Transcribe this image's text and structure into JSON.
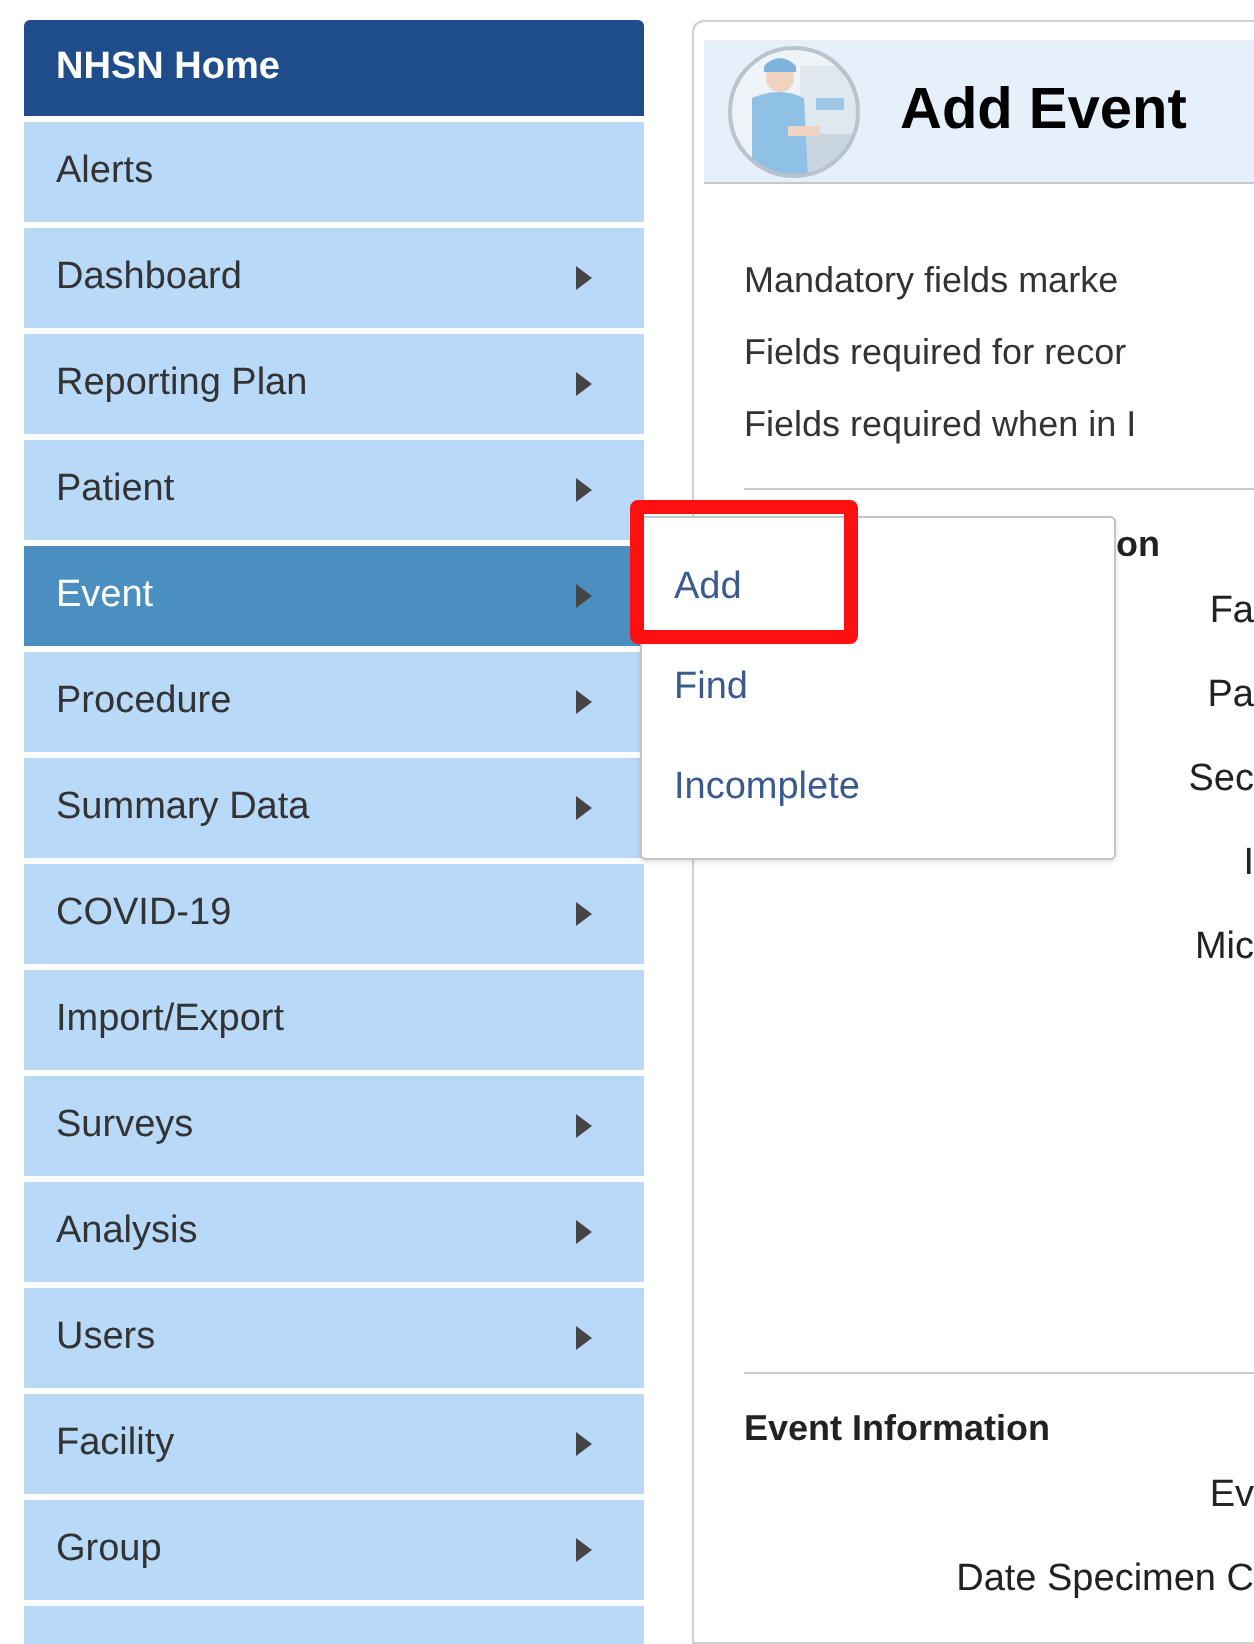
{
  "sidebar": {
    "header": "NHSN Home",
    "items": [
      {
        "label": "Alerts",
        "has_submenu": false,
        "selected": false
      },
      {
        "label": "Dashboard",
        "has_submenu": true,
        "selected": false
      },
      {
        "label": "Reporting Plan",
        "has_submenu": true,
        "selected": false
      },
      {
        "label": "Patient",
        "has_submenu": true,
        "selected": false
      },
      {
        "label": "Event",
        "has_submenu": true,
        "selected": true
      },
      {
        "label": "Procedure",
        "has_submenu": true,
        "selected": false
      },
      {
        "label": "Summary Data",
        "has_submenu": true,
        "selected": false
      },
      {
        "label": "COVID-19",
        "has_submenu": true,
        "selected": false
      },
      {
        "label": "Import/Export",
        "has_submenu": false,
        "selected": false
      },
      {
        "label": "Surveys",
        "has_submenu": true,
        "selected": false
      },
      {
        "label": "Analysis",
        "has_submenu": true,
        "selected": false
      },
      {
        "label": "Users",
        "has_submenu": true,
        "selected": false
      },
      {
        "label": "Facility",
        "has_submenu": true,
        "selected": false
      },
      {
        "label": "Group",
        "has_submenu": true,
        "selected": false
      }
    ]
  },
  "submenu": {
    "items": [
      {
        "label": "Add",
        "highlighted": true
      },
      {
        "label": "Find",
        "highlighted": false
      },
      {
        "label": "Incomplete",
        "highlighted": false
      }
    ]
  },
  "page": {
    "title": "Add Event",
    "notes": [
      "Mandatory fields marke",
      "Fields required for recor",
      "Fields required when in I"
    ],
    "sections": [
      {
        "title": "on",
        "fields": [
          "Fa",
          "Pa",
          "Sec",
          "I",
          "Mic"
        ]
      },
      {
        "title": "Event Information",
        "fields": [
          "Ev",
          "Date Specimen C"
        ]
      }
    ]
  }
}
